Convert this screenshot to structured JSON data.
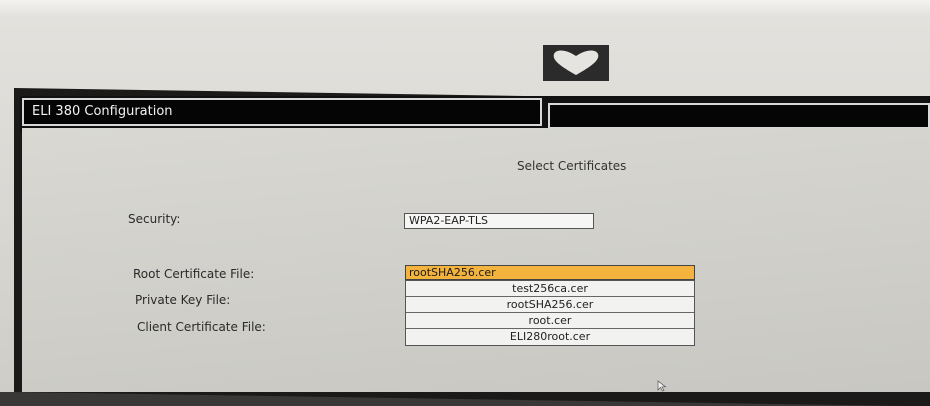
{
  "window": {
    "title": "ELI 380 Configuration"
  },
  "main": {
    "section_title": "Select Certificates",
    "security": {
      "label": "Security:",
      "value": "WPA2-EAP-TLS"
    },
    "root_cert": {
      "label": "Root Certificate File:",
      "selected": "rootSHA256.cer"
    },
    "private_key": {
      "label": "Private Key File:"
    },
    "client_cert": {
      "label": "Client Certificate File:"
    },
    "options": [
      "test256ca.cer",
      "rootSHA256.cer",
      "root.cer",
      "ELI280root.cer"
    ]
  },
  "icons": {
    "brand": "heart-logo-icon",
    "pointer": "mouse-pointer-icon"
  },
  "colors": {
    "highlight": "#f3b33d",
    "titlebar": "#050505",
    "panel": "#d6d5d0"
  }
}
